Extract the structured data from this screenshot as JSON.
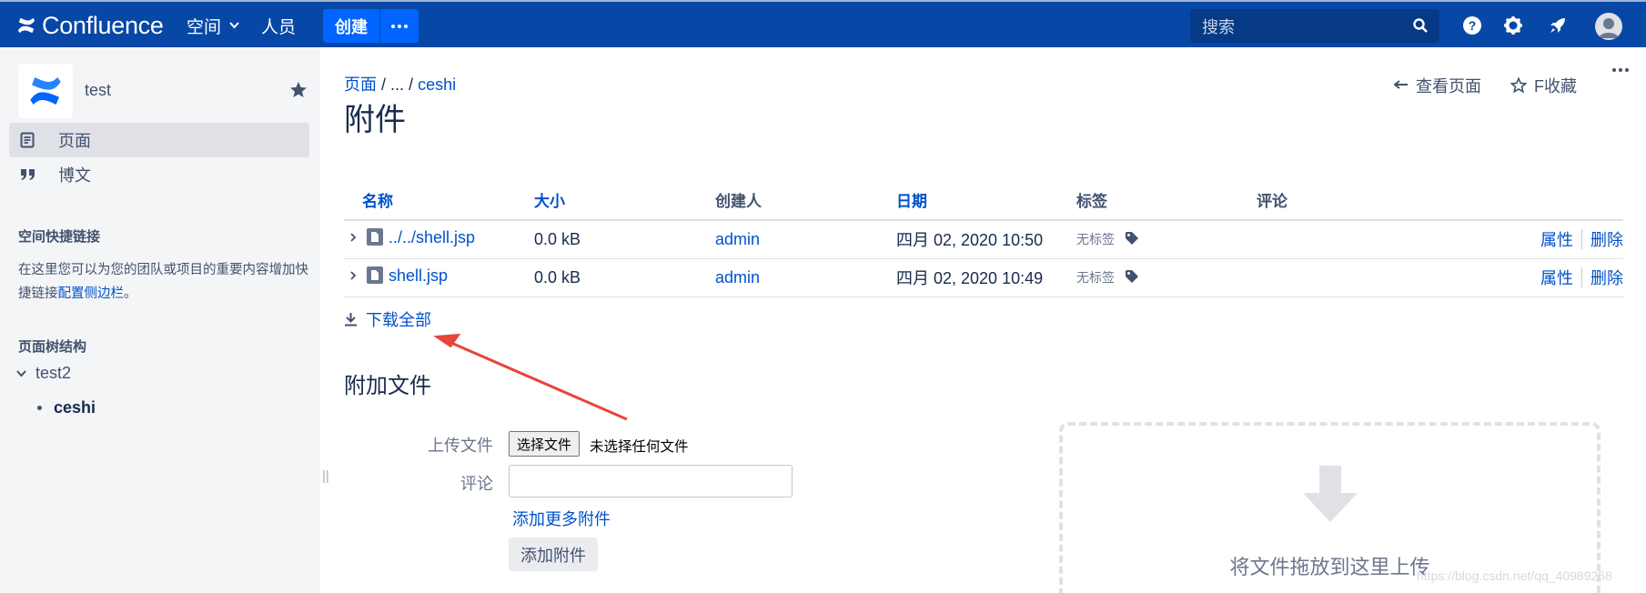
{
  "header": {
    "logo_text": "Confluence",
    "nav": {
      "spaces": "空间",
      "people": "人员"
    },
    "create_label": "创建",
    "more_label": "···",
    "search_placeholder": "搜索"
  },
  "sidebar": {
    "space_name": "test",
    "nav": [
      {
        "label": "页面",
        "icon": "page-icon",
        "active": true
      },
      {
        "label": "博文",
        "icon": "quote-icon",
        "active": false
      }
    ],
    "shortcuts_heading": "空间快捷链接",
    "shortcuts_text": "在这里您可以为您的团队或项目的重要内容增加快捷链接",
    "shortcuts_link": "配置侧边栏",
    "shortcuts_end": "。",
    "tree_heading": "页面树结构",
    "tree": [
      {
        "label": "test2",
        "expanded": true
      },
      {
        "label": "ceshi",
        "current": true
      }
    ]
  },
  "page": {
    "breadcrumb": {
      "root": "页面",
      "sep1": "/",
      "ellipsis": "...",
      "sep2": "/",
      "current": "ceshi"
    },
    "title": "附件",
    "actions": {
      "view_page": "查看页面",
      "favorite": "F收藏",
      "more": "···"
    }
  },
  "attachments": {
    "columns": {
      "name": "名称",
      "size": "大小",
      "creator": "创建人",
      "date": "日期",
      "labels": "标签",
      "comment": "评论"
    },
    "rows": [
      {
        "name": "../../shell.jsp",
        "size": "0.0 kB",
        "creator": "admin",
        "date": "四月 02, 2020 10:50",
        "labels": "无标签",
        "action_props": "属性",
        "action_delete": "删除"
      },
      {
        "name": "shell.jsp",
        "size": "0.0 kB",
        "creator": "admin",
        "date": "四月 02, 2020 10:49",
        "labels": "无标签",
        "action_props": "属性",
        "action_delete": "删除"
      }
    ],
    "download_all": "下载全部"
  },
  "upload": {
    "section_title": "附加文件",
    "file_label": "上传文件",
    "file_button": "选择文件",
    "file_none": "未选择任何文件",
    "comment_label": "评论",
    "add_more": "添加更多附件",
    "submit": "添加附件",
    "drop_text": "将文件拖放到这里上传"
  },
  "watermark": "https://blog.csdn.net/qq_40989258",
  "colors": {
    "header_bg": "#0747a6",
    "link": "#0052cc",
    "annotation_arrow": "#e8453c"
  }
}
